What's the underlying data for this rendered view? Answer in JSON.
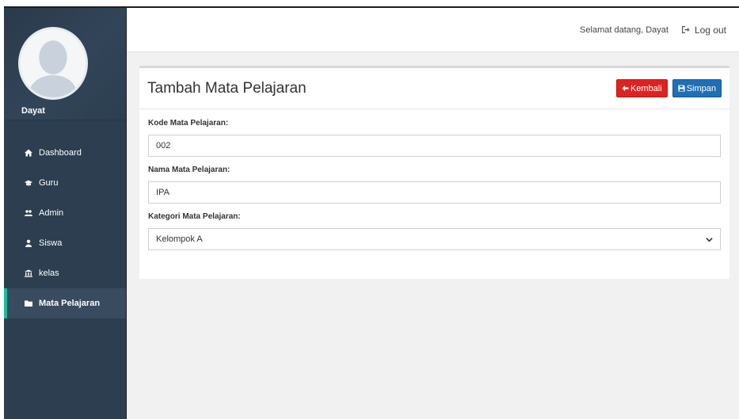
{
  "user": {
    "name": "Dayat"
  },
  "sidebar": {
    "items": [
      {
        "label": "Dashboard",
        "icon": "home-icon",
        "active": false
      },
      {
        "label": "Guru",
        "icon": "graduation-cap-icon",
        "active": false
      },
      {
        "label": "Admin",
        "icon": "users-icon",
        "active": false
      },
      {
        "label": "Siswa",
        "icon": "user-icon",
        "active": false
      },
      {
        "label": "kelas",
        "icon": "institution-icon",
        "active": false
      },
      {
        "label": "Mata Pelajaran",
        "icon": "folder-icon",
        "active": true
      }
    ]
  },
  "topbar": {
    "welcome": "Selamat datang, Dayat",
    "logout_label": "Log out"
  },
  "panel": {
    "title": "Tambah Mata Pelajaran",
    "back_label": "Kembali",
    "save_label": "Simpan"
  },
  "form": {
    "kode": {
      "label": "Kode Mata Pelajaran:",
      "value": "002"
    },
    "nama": {
      "label": "Nama Mata Pelajaran:",
      "value": "IPA"
    },
    "kategori": {
      "label": "Kategori Mata Pelajaran:",
      "value": "Kelompok A"
    }
  },
  "colors": {
    "sidebar_bg": "#2c3e50",
    "active_accent": "#1abc9c",
    "back_button": "#dd2222",
    "save_button": "#1f6fb5"
  }
}
